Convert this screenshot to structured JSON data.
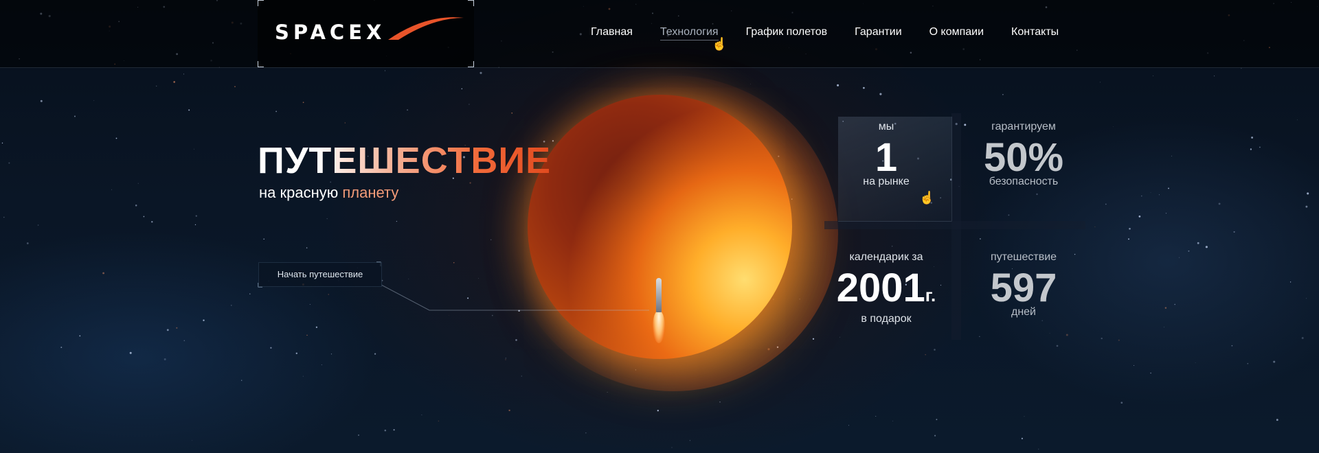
{
  "header": {
    "logo": "SPACEX",
    "nav": [
      {
        "label": "Главная"
      },
      {
        "label": "Технология"
      },
      {
        "label": "График полетов"
      },
      {
        "label": "Гарантии"
      },
      {
        "label": "О компаии"
      },
      {
        "label": "Контакты"
      }
    ]
  },
  "hero": {
    "title": "ПУТЕШЕСТВИЕ",
    "subtitle_prefix": "на красную ",
    "subtitle_accent": "планету",
    "cta": "Начать путешествие"
  },
  "stats": [
    {
      "label": "мы",
      "value": "1",
      "unit": "",
      "caption": "на рынке"
    },
    {
      "label": "гарантируем",
      "value": "50%",
      "unit": "",
      "caption": "безопасность"
    },
    {
      "label": "календарик за",
      "value": "2001",
      "unit": "г.",
      "caption": "в подарок"
    },
    {
      "label": "путешествие",
      "value": "597",
      "unit": "",
      "caption": "дней"
    }
  ],
  "colors": {
    "accent": "#f26a3a",
    "background": "#0a1626"
  }
}
